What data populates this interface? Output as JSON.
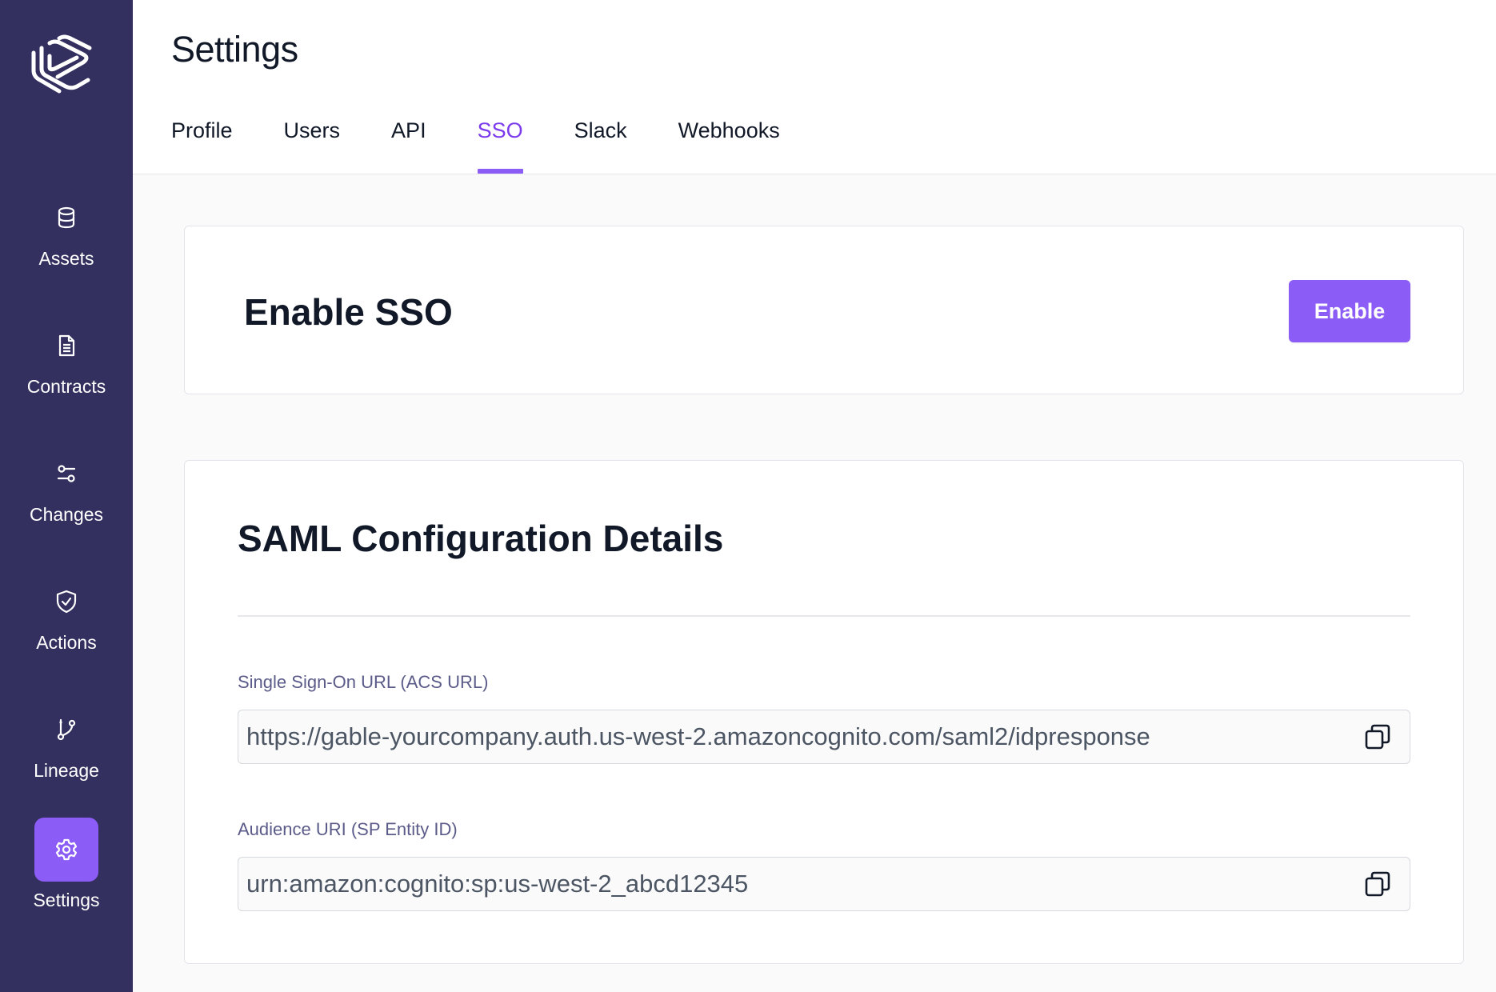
{
  "page": {
    "title": "Settings"
  },
  "sidebar": {
    "logo": "gable-logo",
    "items": [
      {
        "label": "Assets",
        "icon": "database-icon",
        "active": false
      },
      {
        "label": "Contracts",
        "icon": "document-icon",
        "active": false
      },
      {
        "label": "Changes",
        "icon": "sliders-icon",
        "active": false
      },
      {
        "label": "Actions",
        "icon": "shield-check-icon",
        "active": false
      },
      {
        "label": "Lineage",
        "icon": "git-branch-icon",
        "active": false
      },
      {
        "label": "Settings",
        "icon": "gear-icon",
        "active": true
      }
    ]
  },
  "tabs": [
    {
      "label": "Profile",
      "active": false
    },
    {
      "label": "Users",
      "active": false
    },
    {
      "label": "API",
      "active": false
    },
    {
      "label": "SSO",
      "active": true
    },
    {
      "label": "Slack",
      "active": false
    },
    {
      "label": "Webhooks",
      "active": false
    }
  ],
  "sso_card": {
    "title": "Enable SSO",
    "button_label": "Enable"
  },
  "saml_card": {
    "title": "SAML Configuration Details",
    "fields": [
      {
        "label": "Single Sign-On URL (ACS URL)",
        "value": "https://gable-yourcompany.auth.us-west-2.amazoncognito.com/saml2/idpresponse"
      },
      {
        "label": "Audience URI (SP Entity ID)",
        "value": "urn:amazon:cognito:sp:us-west-2_abcd12345"
      }
    ]
  },
  "colors": {
    "sidebar": "#33305f",
    "accent": "#8b5cf6",
    "accent_text": "#7c3aed",
    "label": "#5b5b8a"
  }
}
